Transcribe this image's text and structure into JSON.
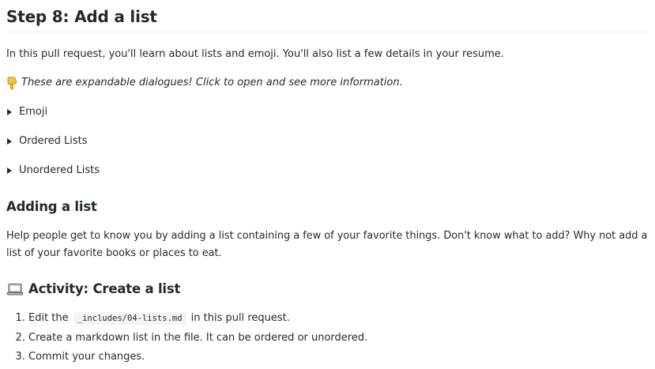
{
  "title": "Step 8: Add a list",
  "intro": "In this pull request, you'll learn about lists and emoji. You'll also list a few details in your resume.",
  "hint": "These are expandable dialogues! Click to open and see more information.",
  "hint_icon": "backhand-index-pointing-down-icon",
  "details": [
    {
      "summary": "Emoji"
    },
    {
      "summary": "Ordered Lists"
    },
    {
      "summary": "Unordered Lists"
    }
  ],
  "adding": {
    "heading": "Adding a list",
    "text": "Help people get to know you by adding a list containing a few of your favorite things. Don't know what to add? Why not add a list of your favorite books or places to eat."
  },
  "activity": {
    "heading": "Activity: Create a list",
    "icon": "laptop-icon",
    "steps": [
      {
        "before": "Edit the ",
        "code": "_includes/04-lists.md",
        "after": " in this pull request."
      },
      {
        "text": "Create a markdown list in the file. It can be ordered or unordered."
      },
      {
        "text": "Commit your changes."
      }
    ]
  },
  "colors": {
    "text": "#24292e",
    "rule": "#eaecef",
    "code_bg": "#f3f4f4",
    "emoji_yellow": "#f7c644"
  }
}
